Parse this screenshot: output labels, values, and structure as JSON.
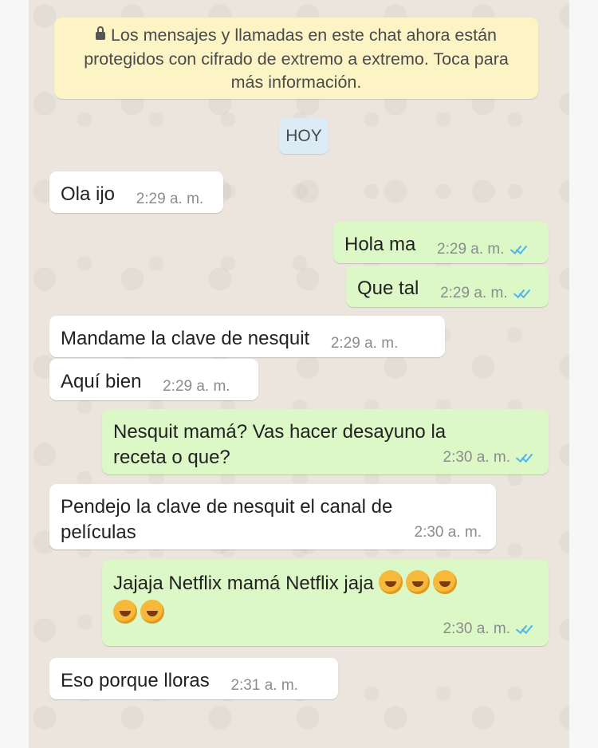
{
  "notice": {
    "lines": [
      "Los mensajes y llamadas en este chat ahora están",
      "protegidos con cifrado de extremo a extremo. Toca para",
      "más información."
    ]
  },
  "date_label": "HOY",
  "messages": [
    {
      "dir": "in",
      "lines": [
        "Ola ijo"
      ],
      "time": "2:29 a. m."
    },
    {
      "dir": "out",
      "lines": [
        "Hola ma"
      ],
      "time": "2:29 a. m.",
      "status": "read"
    },
    {
      "dir": "out",
      "lines": [
        "Que tal"
      ],
      "time": "2:29 a. m.",
      "status": "read"
    },
    {
      "dir": "in",
      "lines": [
        "Mandame la clave de nesquit"
      ],
      "time": "2:29 a. m."
    },
    {
      "dir": "in",
      "lines": [
        "Aquí bien"
      ],
      "time": "2:29 a. m."
    },
    {
      "dir": "out",
      "lines": [
        "Nesquit mamá? Vas hacer desayuno la",
        "receta o que?"
      ],
      "time": "2:30 a. m.",
      "status": "read"
    },
    {
      "dir": "in",
      "lines": [
        "Pendejo la clave de nesquit el canal de",
        "películas"
      ],
      "time": "2:30 a. m."
    },
    {
      "dir": "out",
      "lines": [
        "Jajaja Netflix mamá Netflix jaja"
      ],
      "emoji_count": 5,
      "emoji_name": "rolling-on-floor-laughing",
      "time": "2:30 a. m.",
      "status": "read"
    },
    {
      "dir": "in",
      "lines": [
        "Eso  porque lloras"
      ],
      "time": "2:31 a. m."
    }
  ]
}
